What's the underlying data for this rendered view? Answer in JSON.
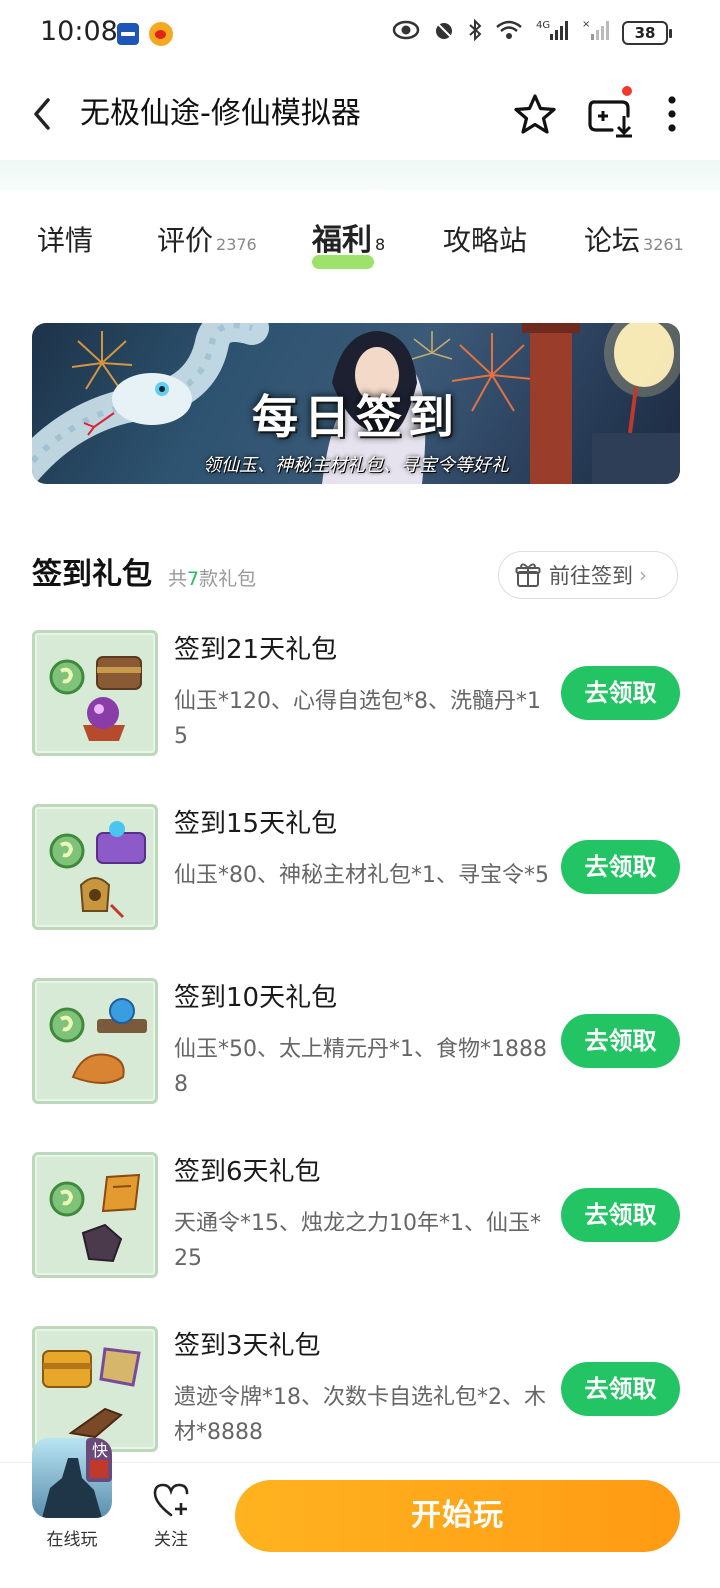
{
  "status_bar": {
    "time": "10:08",
    "battery": "38"
  },
  "header": {
    "title": "无极仙途-修仙模拟器"
  },
  "tabs": [
    {
      "label": "详情",
      "count": ""
    },
    {
      "label": "评价",
      "count": "2376"
    },
    {
      "label": "福利",
      "count": "8"
    },
    {
      "label": "攻略站",
      "count": ""
    },
    {
      "label": "论坛",
      "count": "3261"
    }
  ],
  "banner": {
    "title": "每日签到",
    "subtitle": "领仙玉、神秘主材礼包、寻宝令等好礼"
  },
  "section": {
    "title": "签到礼包",
    "count_prefix": "共",
    "count_num": "7",
    "count_suffix": "款礼包",
    "checkin_label": "前往签到"
  },
  "gifts": [
    {
      "name": "签到21天礼包",
      "desc": "仙玉*120、心得自选包*8、洗髓丹*15",
      "button": "去领取"
    },
    {
      "name": "签到15天礼包",
      "desc": "仙玉*80、神秘主材礼包*1、寻宝令*5",
      "button": "去领取"
    },
    {
      "name": "签到10天礼包",
      "desc": "仙玉*50、太上精元丹*1、食物*18888",
      "button": "去领取"
    },
    {
      "name": "签到6天礼包",
      "desc": "天通令*15、烛龙之力10年*1、仙玉*25",
      "button": "去领取"
    },
    {
      "name": "签到3天礼包",
      "desc": "遗迹令牌*18、次数卡自选礼包*2、木材*8888",
      "button": "去领取"
    }
  ],
  "bottom_bar": {
    "online_play": "在线玩",
    "follow": "关注",
    "start_play": "开始玩",
    "game_badge": "快"
  },
  "colors": {
    "accent_green": "#23c464",
    "play_orange": "#ff9b14",
    "tab_highlight": "#9de36b"
  }
}
